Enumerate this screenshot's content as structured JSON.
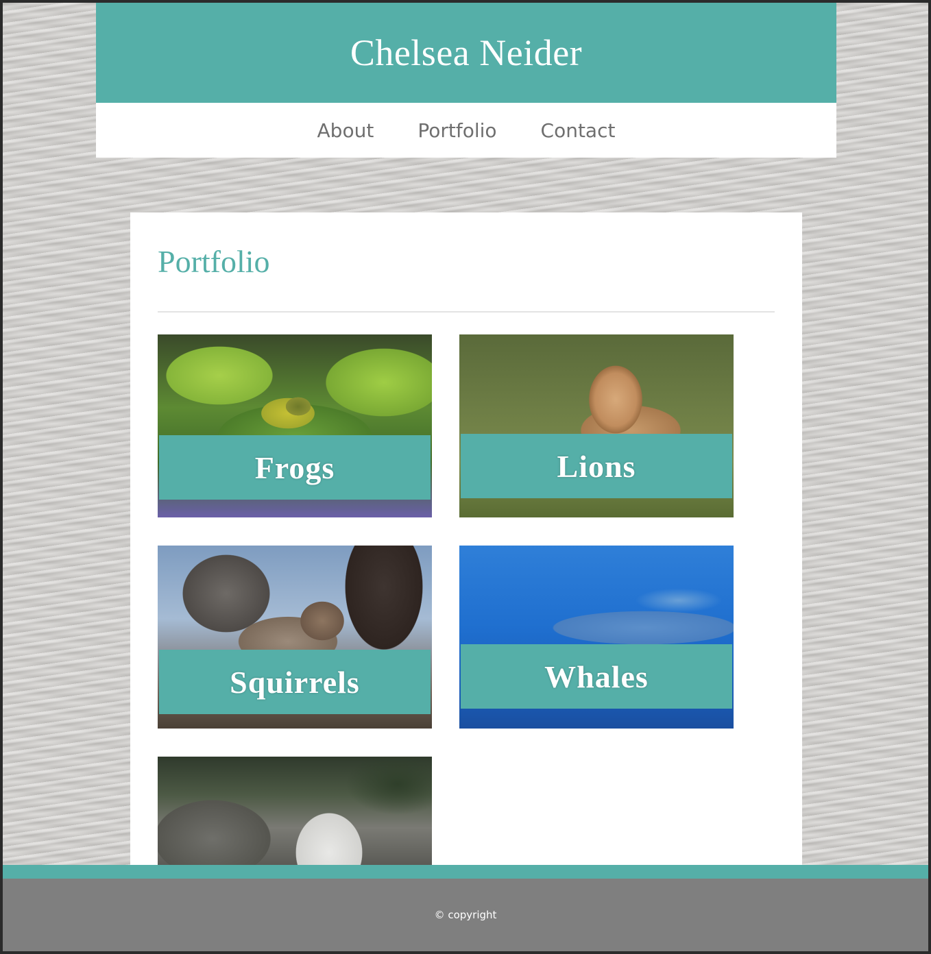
{
  "header": {
    "site_title": "Chelsea Neider"
  },
  "nav": {
    "items": [
      "About",
      "Portfolio",
      "Contact"
    ]
  },
  "main": {
    "page_title": "Portfolio",
    "tiles": [
      {
        "label": "Frogs"
      },
      {
        "label": "Lions"
      },
      {
        "label": "Squirrels"
      },
      {
        "label": "Whales"
      },
      {
        "label": ""
      }
    ]
  },
  "footer": {
    "copyright": "© copyright"
  },
  "colors": {
    "accent": "#55afa8",
    "footer": "#7f7f7f",
    "nav_text": "#6f6f6f"
  }
}
